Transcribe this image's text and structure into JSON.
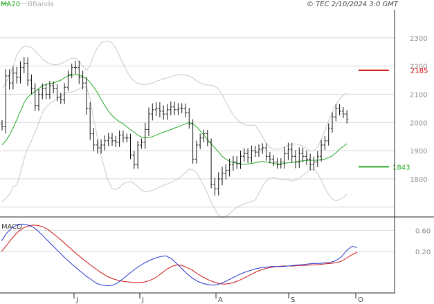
{
  "header": {
    "legend_ma": "MA20",
    "legend_bb": "BBands",
    "copyright": "© TEC 2/10/2024 3:0 GMT"
  },
  "macd_panel": {
    "label": "MACD"
  },
  "colors": {
    "grid": "#d8d8d8",
    "frame": "#222222",
    "candles": "#111111",
    "ma": "#22aa22",
    "bbands": "#c8c8c8",
    "resistance": "#cc0000",
    "support": "#22aa22",
    "macd_line": "#2233cc",
    "signal_line": "#cc1111"
  },
  "chart_data": [
    {
      "type": "ohlc",
      "y_ticks": [
        1800,
        1900,
        2000,
        2100,
        2200,
        2300
      ],
      "y_tick_labels": [
        "1800",
        "1900",
        "2000",
        "2100",
        "2200",
        "2300"
      ],
      "ylim": [
        1670,
        2390
      ],
      "x_month_labels": [
        "J",
        "J",
        "A",
        "S",
        "O"
      ],
      "legend": [
        "MA20",
        "BBands"
      ],
      "levels": [
        {
          "name": "resistance",
          "value": 2185,
          "label": "2185"
        },
        {
          "name": "support",
          "value": 1843,
          "label": "1843"
        }
      ],
      "close": [
        1985,
        2165,
        2140,
        2175,
        2160,
        2195,
        2210,
        2150,
        2120,
        2060,
        2100,
        2120,
        2100,
        2130,
        2120,
        2090,
        2080,
        2125,
        2170,
        2195,
        2195,
        2160,
        2140,
        2050,
        1960,
        1920,
        1910,
        1920,
        1935,
        1945,
        1935,
        1930,
        1955,
        1945,
        1945,
        1885,
        1850,
        1920,
        1930,
        1975,
        2030,
        2045,
        2050,
        2040,
        2030,
        2045,
        2055,
        2045,
        2050,
        2050,
        2035,
        1995,
        1870,
        1920,
        1945,
        1960,
        1930,
        1780,
        1765,
        1800,
        1820,
        1830,
        1850,
        1860,
        1855,
        1880,
        1890,
        1875,
        1900,
        1895,
        1905,
        1910,
        1880,
        1870,
        1860,
        1850,
        1860,
        1890,
        1905,
        1880,
        1860,
        1890,
        1880,
        1870,
        1850,
        1860,
        1880,
        1920,
        1935,
        1980,
        2020,
        2050,
        2040,
        2030,
        2010
      ],
      "ma20": [
        1920,
        1935,
        1955,
        1980,
        2010,
        2040,
        2070,
        2090,
        2100,
        2110,
        2120,
        2130,
        2135,
        2138,
        2140,
        2145,
        2150,
        2158,
        2165,
        2168,
        2170,
        2168,
        2163,
        2155,
        2142,
        2125,
        2105,
        2082,
        2060,
        2040,
        2024,
        2012,
        2003,
        1995,
        1985,
        1975,
        1965,
        1955,
        1948,
        1945,
        1946,
        1950,
        1955,
        1961,
        1966,
        1970,
        1975,
        1980,
        1985,
        1990,
        1995,
        2000,
        1995,
        1985,
        1970,
        1955,
        1940,
        1925,
        1910,
        1895,
        1880,
        1870,
        1862,
        1858,
        1855,
        1853,
        1852,
        1853,
        1855,
        1857,
        1860,
        1862,
        1860,
        1858,
        1855,
        1853,
        1853,
        1855,
        1857,
        1858,
        1860,
        1862,
        1864,
        1865,
        1866,
        1866,
        1866,
        1868,
        1870,
        1875,
        1882,
        1892,
        1905,
        1915,
        1925
      ],
      "bb_upper": [
        2120,
        2140,
        2165,
        2195,
        2240,
        2260,
        2270,
        2270,
        2265,
        2255,
        2240,
        2225,
        2215,
        2208,
        2205,
        2205,
        2208,
        2214,
        2222,
        2228,
        2228,
        2218,
        2200,
        2185,
        2200,
        2240,
        2265,
        2282,
        2288,
        2288,
        2282,
        2262,
        2236,
        2208,
        2182,
        2160,
        2146,
        2138,
        2135,
        2135,
        2136,
        2140,
        2146,
        2150,
        2155,
        2158,
        2162,
        2166,
        2169,
        2170,
        2168,
        2165,
        2158,
        2148,
        2140,
        2135,
        2132,
        2132,
        2128,
        2118,
        2098,
        2073,
        2048,
        2028,
        2011,
        2000,
        1993,
        1990,
        1990,
        1990,
        1970,
        1950,
        1928,
        1912,
        1905,
        1906,
        1908,
        1912,
        1918,
        1924,
        1924,
        1922,
        1915,
        1908,
        1898,
        1900,
        1912,
        1940,
        1972,
        2005,
        2035,
        2062,
        2083,
        2096,
        2104
      ],
      "bb_lower": [
        1720,
        1730,
        1745,
        1770,
        1780,
        1820,
        1870,
        1910,
        1935,
        1965,
        1999,
        2035,
        2055,
        2068,
        2075,
        2085,
        2092,
        2102,
        2108,
        2108,
        2112,
        2118,
        2126,
        2125,
        2084,
        2010,
        1945,
        1882,
        1832,
        1792,
        1766,
        1762,
        1770,
        1782,
        1788,
        1790,
        1784,
        1772,
        1761,
        1755,
        1756,
        1760,
        1764,
        1772,
        1777,
        1782,
        1788,
        1794,
        1801,
        1810,
        1822,
        1835,
        1832,
        1822,
        1800,
        1775,
        1748,
        1718,
        1692,
        1672,
        1662,
        1667,
        1676,
        1688,
        1699,
        1706,
        1711,
        1716,
        1720,
        1724,
        1750,
        1774,
        1792,
        1804,
        1805,
        1800,
        1798,
        1798,
        1796,
        1792,
        1796,
        1802,
        1813,
        1822,
        1834,
        1832,
        1820,
        1796,
        1768,
        1745,
        1729,
        1722,
        1727,
        1734,
        1746
      ],
      "last_close": 2010
    },
    {
      "type": "line",
      "title": "MACD",
      "series": [
        {
          "name": "MACD",
          "values": [
            0.4,
            0.55,
            0.65,
            0.7,
            0.72,
            0.7,
            0.66,
            0.58,
            0.48,
            0.38,
            0.28,
            0.18,
            0.08,
            -0.01,
            -0.1,
            -0.18,
            -0.26,
            -0.33,
            -0.4,
            -0.43,
            -0.44,
            -0.43,
            -0.38,
            -0.3,
            -0.22,
            -0.14,
            -0.07,
            -0.01,
            0.04,
            0.08,
            0.11,
            0.12,
            0.07,
            -0.02,
            -0.12,
            -0.22,
            -0.3,
            -0.36,
            -0.4,
            -0.42,
            -0.43,
            -0.41,
            -0.37,
            -0.32,
            -0.27,
            -0.22,
            -0.18,
            -0.15,
            -0.12,
            -0.1,
            -0.09,
            -0.08,
            -0.08,
            -0.08,
            -0.07,
            -0.06,
            -0.05,
            -0.04,
            -0.03,
            -0.02,
            -0.02,
            -0.01,
            0.0,
            0.03,
            0.1,
            0.22,
            0.3,
            0.28
          ]
        },
        {
          "name": "Signal",
          "values": [
            0.2,
            0.32,
            0.45,
            0.56,
            0.64,
            0.68,
            0.7,
            0.69,
            0.66,
            0.6,
            0.52,
            0.44,
            0.35,
            0.26,
            0.17,
            0.09,
            0.01,
            -0.07,
            -0.14,
            -0.21,
            -0.27,
            -0.31,
            -0.34,
            -0.36,
            -0.37,
            -0.38,
            -0.38,
            -0.37,
            -0.34,
            -0.29,
            -0.22,
            -0.14,
            -0.08,
            -0.05,
            -0.06,
            -0.1,
            -0.15,
            -0.22,
            -0.28,
            -0.33,
            -0.37,
            -0.4,
            -0.41,
            -0.4,
            -0.37,
            -0.33,
            -0.28,
            -0.23,
            -0.18,
            -0.14,
            -0.11,
            -0.09,
            -0.08,
            -0.07,
            -0.07,
            -0.07,
            -0.06,
            -0.06,
            -0.05,
            -0.05,
            -0.04,
            -0.03,
            -0.02,
            -0.01,
            0.02,
            0.08,
            0.14,
            0.19
          ]
        }
      ],
      "y_ticks": [
        0.2,
        0.6
      ],
      "y_tick_labels": [
        "0.20",
        "0.60"
      ],
      "ylim": [
        -0.55,
        0.8
      ]
    }
  ]
}
